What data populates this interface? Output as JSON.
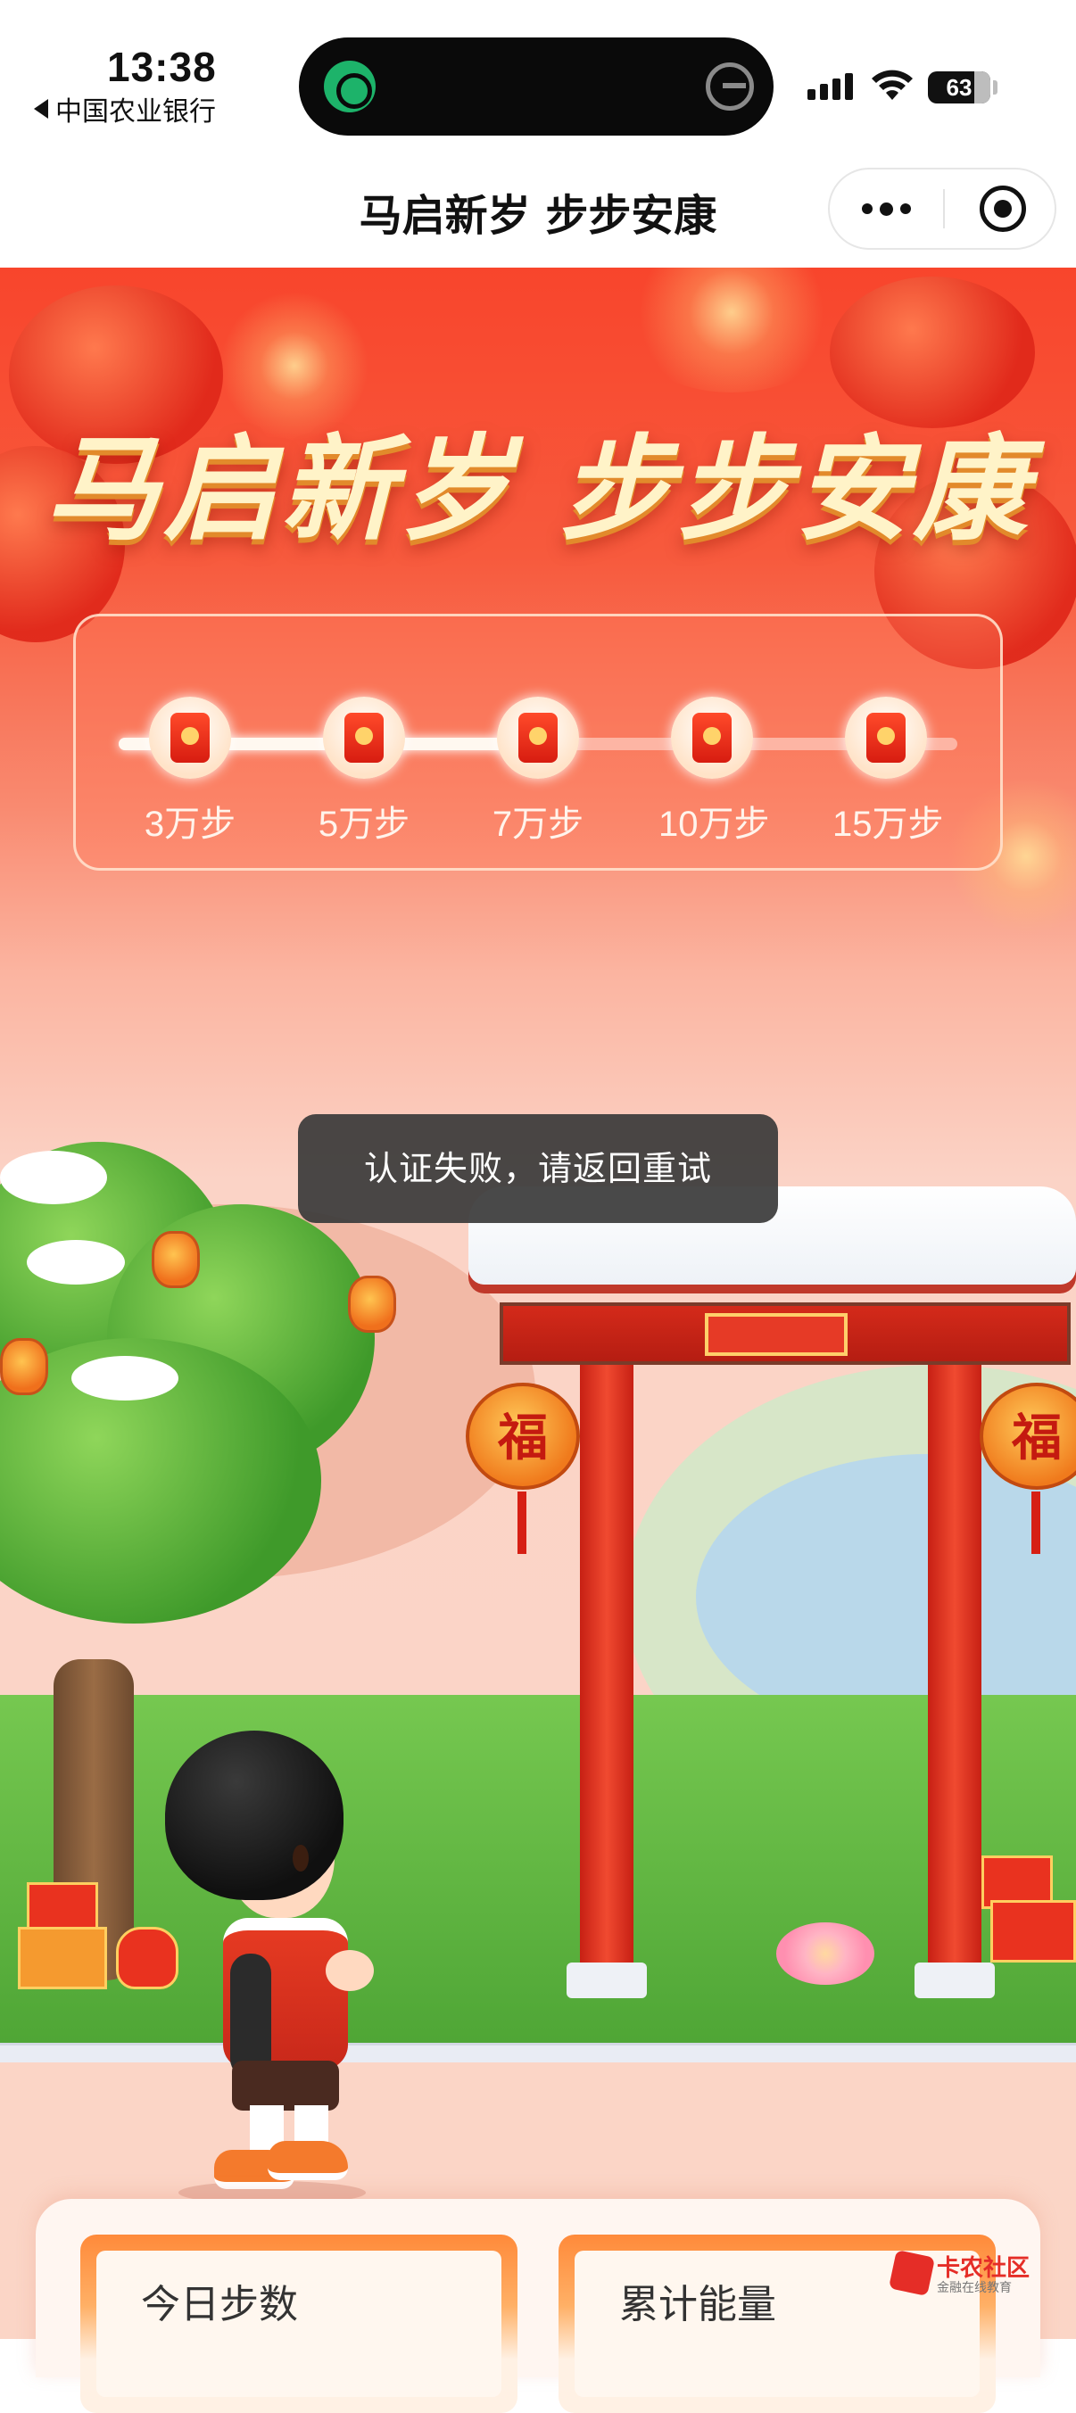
{
  "status_bar": {
    "time": "13:38",
    "back_app": "中国农业银行",
    "battery": "63"
  },
  "nav": {
    "title": "马启新岁 步步安康"
  },
  "hero": {
    "title": "马启新岁 步步安康"
  },
  "milestones": {
    "progress_fraction": 0.5,
    "items": [
      {
        "label": "3万步"
      },
      {
        "label": "5万步"
      },
      {
        "label": "7万步"
      },
      {
        "label": "10万步"
      },
      {
        "label": "15万步"
      }
    ]
  },
  "decor": {
    "fu_char": "福"
  },
  "toast": {
    "message": "认证失败，请返回重试"
  },
  "stats": {
    "today_steps_label": "今日步数",
    "total_energy_label": "累计能量"
  },
  "watermark": {
    "name": "卡农社区",
    "sub": "金融在线教育"
  },
  "colors": {
    "accent_red": "#f8452c",
    "toast_bg": "#3a3a3a",
    "gold_title": "#fff3c8"
  }
}
